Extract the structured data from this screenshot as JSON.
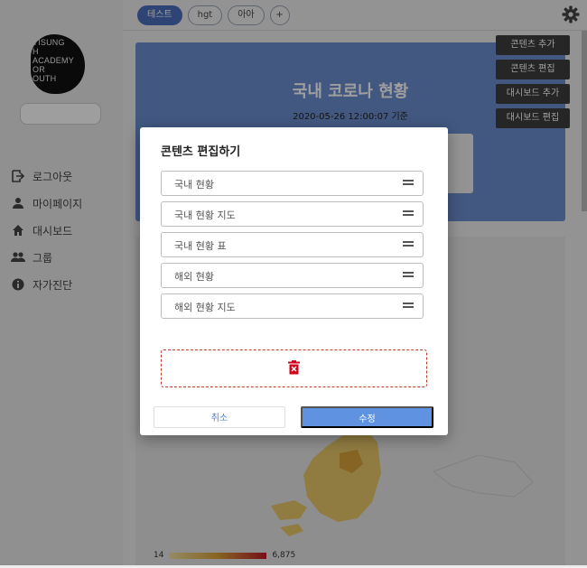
{
  "logo": {
    "lines": [
      "YISUNG",
      "H",
      "ACADEMY",
      "OR",
      "OUTH"
    ]
  },
  "sidebar": {
    "items": [
      {
        "label": "로그아웃",
        "icon": "logout-icon"
      },
      {
        "label": "마이페이지",
        "icon": "person-icon"
      },
      {
        "label": "대시보드",
        "icon": "home-icon"
      },
      {
        "label": "그룹",
        "icon": "group-icon"
      },
      {
        "label": "자가진단",
        "icon": "info-icon"
      }
    ]
  },
  "tabs": [
    {
      "label": "테스트",
      "active": true
    },
    {
      "label": "hgt",
      "active": false
    },
    {
      "label": "아아",
      "active": false
    },
    {
      "label": "+",
      "active": false
    }
  ],
  "dashboard": {
    "title": "국내 코로나 현황",
    "date": "2020-05-26 12:00:07 기준",
    "side_buttons": [
      "콘텐츠 추가",
      "콘텐츠 편집",
      "대시보드 추가",
      "대시보드 편집"
    ],
    "legend_min": "14",
    "legend_max": "6,875"
  },
  "modal": {
    "title": "콘텐츠 편집하기",
    "items": [
      "국내 현황",
      "국내 현황 지도",
      "국내 현황 표",
      "해외 현황",
      "해외 현황 지도"
    ],
    "cancel_label": "취소",
    "confirm_label": "수정"
  },
  "colors": {
    "accent": "#5f92e0",
    "card_blue": "#6b8fcf",
    "danger": "#c0392b"
  }
}
